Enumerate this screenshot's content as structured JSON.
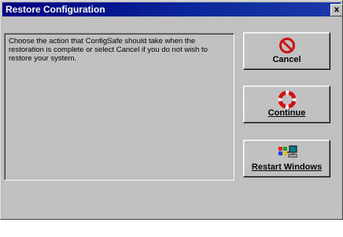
{
  "window": {
    "title": "Restore Configuration",
    "close_glyph": "x"
  },
  "message": {
    "text": "Choose the action that ConfigSafe should take when the restoration is complete or select Cancel if you do not wish to restore your system."
  },
  "buttons": {
    "cancel": {
      "label": "Cancel",
      "icon": "no-entry-icon"
    },
    "continue": {
      "label": "Continue",
      "icon": "lifebuoy-icon"
    },
    "restart": {
      "label": "Restart Windows",
      "icon": "computer-icon"
    }
  },
  "colors": {
    "titlebar": "#000080",
    "face": "#c0c0c0",
    "cancel_icon": "#d01010",
    "continue_icon": "#d01010"
  }
}
